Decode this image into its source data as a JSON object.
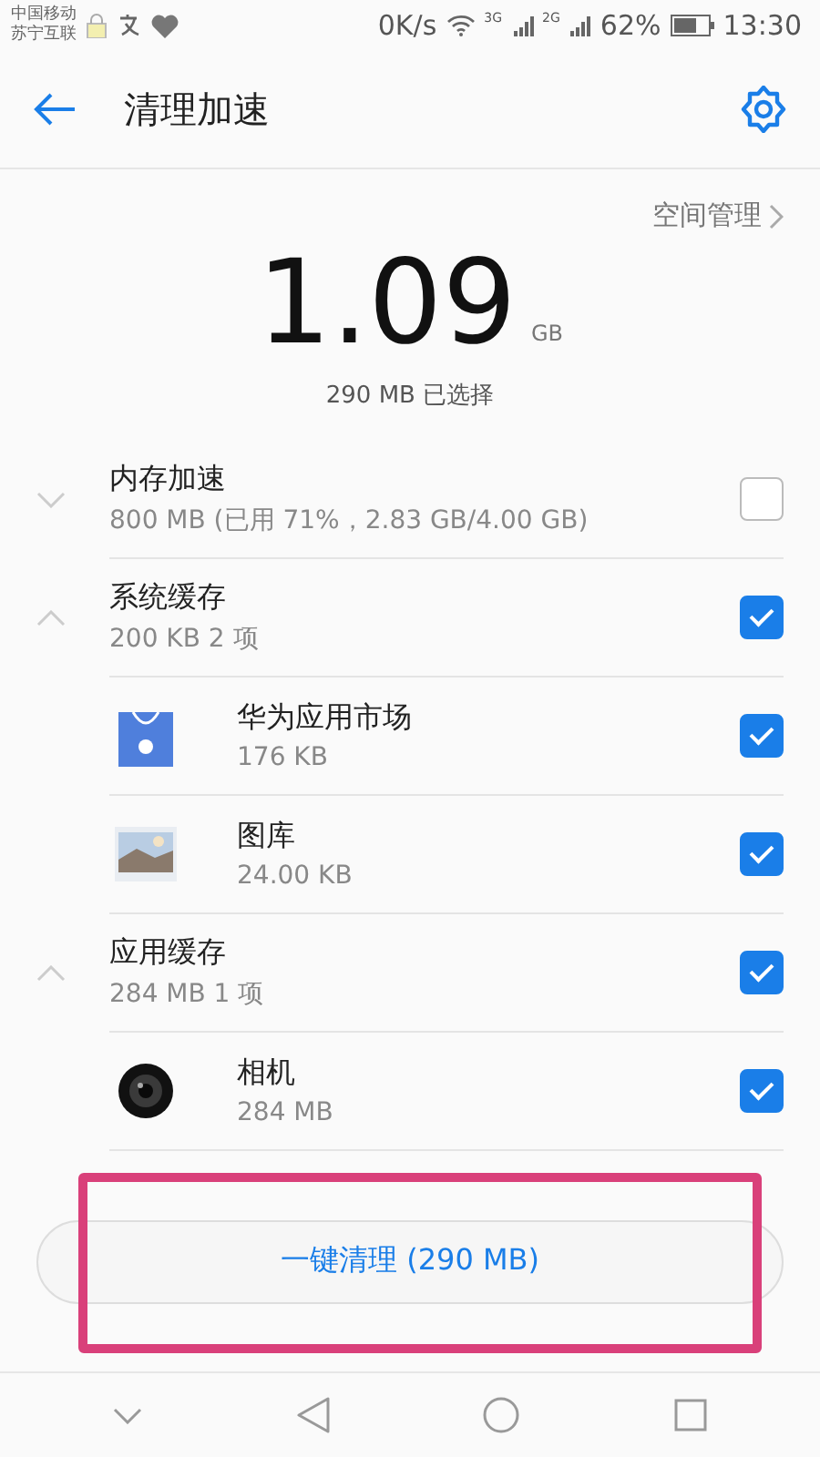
{
  "status_bar": {
    "carriers": [
      "中国移动",
      "苏宁互联"
    ],
    "speed": "0K/s",
    "network_1": "3G",
    "network_2": "2G",
    "battery": "62%",
    "time": "13:30"
  },
  "header": {
    "title": "清理加速"
  },
  "summary": {
    "link": "空间管理",
    "amount": "1.09",
    "unit": "GB",
    "selected": "290 MB 已选择"
  },
  "groups": [
    {
      "title": "内存加速",
      "detail": "800 MB (已用 71%，2.83 GB/4.00 GB)",
      "expanded": false,
      "checked": false
    },
    {
      "title": "系统缓存",
      "detail": "200 KB  2 项",
      "expanded": true,
      "checked": true,
      "children": [
        {
          "kind": "market",
          "name": "华为应用市场",
          "size": "176 KB",
          "checked": true
        },
        {
          "kind": "gallery",
          "name": "图库",
          "size": "24.00 KB",
          "checked": true
        }
      ]
    },
    {
      "title": "应用缓存",
      "detail": "284 MB  1 项",
      "expanded": true,
      "checked": true,
      "children": [
        {
          "kind": "camera",
          "name": "相机",
          "size": "284 MB",
          "checked": true
        }
      ]
    }
  ],
  "clean_button": "一键清理 (290 MB)"
}
